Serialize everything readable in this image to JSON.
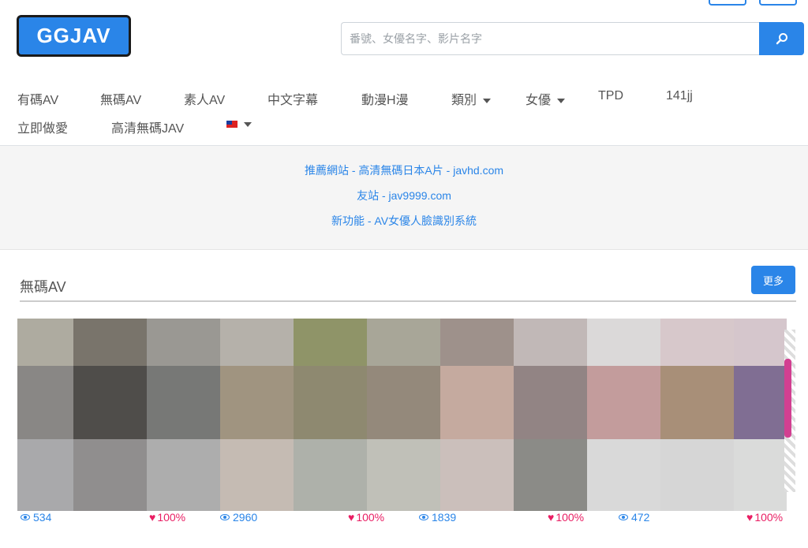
{
  "header": {
    "logo_text": "GGJAV",
    "search_placeholder": "番號、女優名字、影片名字",
    "search_icon": "search-icon"
  },
  "nav": {
    "items": [
      "有碼AV",
      "無碼AV",
      "素人AV",
      "中文字幕",
      "動漫H漫",
      "類別",
      "女優",
      "TPD",
      "141jj",
      "立即做愛",
      "高清無碼JAV"
    ],
    "language_flag": "taiwan-flag-icon"
  },
  "banner": {
    "links": [
      "推薦網站 - 高清無碼日本A片 - javhd.com",
      "友站 - jav9999.com",
      "新功能 - AV女優人臉識別系統"
    ]
  },
  "section": {
    "title": "無碼AV",
    "more_label": "更多"
  },
  "videos": [
    {
      "views": "534",
      "likes": "100%"
    },
    {
      "views": "2960",
      "likes": "100%"
    },
    {
      "views": "1839",
      "likes": "100%"
    },
    {
      "views": "472",
      "likes": "100%"
    }
  ],
  "colors": {
    "accent": "#2a85e8",
    "like": "#e91e63"
  }
}
